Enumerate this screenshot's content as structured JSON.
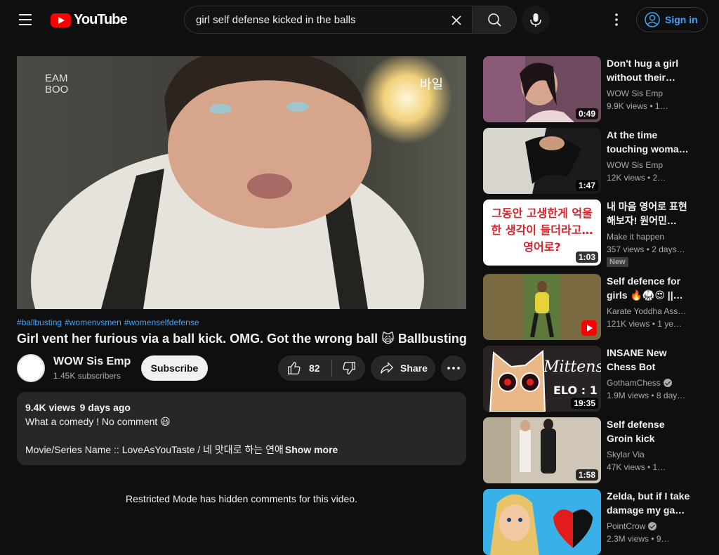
{
  "header": {
    "logo_text": "YouTube",
    "search_value": "girl self defense kicked in the balls",
    "signin_label": "Sign in"
  },
  "video": {
    "hashtags": [
      "#ballbusting",
      "#womenvsmen",
      "#womenselfdefense"
    ],
    "title": "Girl vent her furious via a ball kick. OMG. Got the wrong ball 🙀 Ballbusting",
    "overlay_text": "바일"
  },
  "channel": {
    "name": "WOW Sis Emp",
    "subscribers": "1.45K subscribers",
    "subscribe_label": "Subscribe"
  },
  "actions": {
    "likes": "82",
    "share_label": "Share"
  },
  "description": {
    "views": "9.4K views",
    "date": "9 days ago",
    "line1": "What a comedy ! No comment 😃",
    "line2": "Movie/Series Name :: LoveAsYouTaste / 네 맛대로 하는 연애",
    "show_more": "Show more"
  },
  "restricted_notice": "Restricted Mode has hidden comments for this video.",
  "recommendations": [
    {
      "title": "Don't hug a girl without their…",
      "channel": "WOW Sis Emp",
      "meta": "9.9K views • 1…",
      "duration": "0:49"
    },
    {
      "title": "At the time touching woma…",
      "channel": "WOW Sis Emp",
      "meta": "12K views • 2…",
      "duration": "1:47"
    },
    {
      "title": "내 마음 영어로 표현해보자! 원어민…",
      "channel": "Make it happen",
      "meta": "357 views • 2 days…",
      "duration": "1:03",
      "badge": "New",
      "thumb_text": "그동안 고생한게 억울한 생각이 들더라고…영어로?"
    },
    {
      "title": "Self defence for girls 🔥🥋😍 ||…",
      "channel": "Karate Yoddha Ass…",
      "meta": "121K views • 1 ye…",
      "duration": ""
    },
    {
      "title": "INSANE New Chess Bot",
      "channel": "GothamChess",
      "meta": "1.9M views • 8 day…",
      "duration": "19:35",
      "thumb_text": "Mittens",
      "thumb_text2": "ELO : 1"
    },
    {
      "title": "Self defense Groin kick",
      "channel": "Skylar Via",
      "meta": "47K views • 1…",
      "duration": "1:58"
    },
    {
      "title": "Zelda, but if I take damage my ga…",
      "channel": "PointCrow",
      "meta": "2.3M views • 9…",
      "duration": ""
    }
  ]
}
